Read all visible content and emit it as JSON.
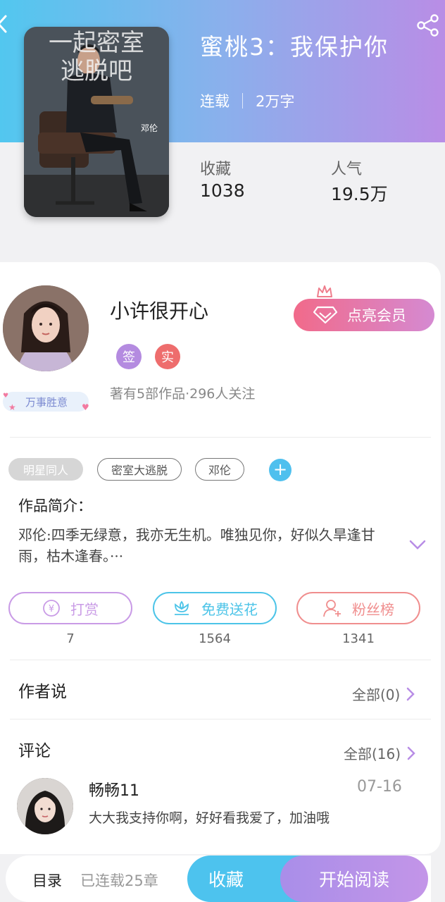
{
  "book": {
    "title": "蜜桃3：我保护你",
    "status": "连载",
    "word_count": "2万字",
    "favorites_label": "收藏",
    "favorites_value": "1038",
    "popularity_label": "人气",
    "popularity_value": "19.5万",
    "cover_text_top": "一起密室",
    "cover_text_bottom": "逃脱吧",
    "cover_author": "邓伦"
  },
  "author": {
    "name": "小许很开心",
    "badge_sign": "签",
    "badge_real": "实",
    "stats": "著有5部作品·296人关注",
    "deco_tag": "万事胜意",
    "vip_button": "点亮会员"
  },
  "tags": [
    "明星同人",
    "密室大逃脱",
    "邓伦"
  ],
  "intro": {
    "title": "作品简介：",
    "text": "邓伦:四季无绿意，我亦无生机。唯独见你，好似久旱逢甘雨，枯木逢春。···"
  },
  "actions": [
    {
      "label": "打赏",
      "count": "7",
      "color": "#c99be6",
      "icon": "yuan-icon"
    },
    {
      "label": "免费送花",
      "count": "1564",
      "color": "#4cc4e8",
      "icon": "flower-icon"
    },
    {
      "label": "粉丝榜",
      "count": "1341",
      "color": "#f08e8e",
      "icon": "fans-icon"
    }
  ],
  "author_says": {
    "title": "作者说",
    "more": "全部(0)"
  },
  "comments": {
    "title": "评论",
    "more": "全部(16)",
    "items": [
      {
        "name": "畅畅11",
        "date": "07-16",
        "text": "大大我支持你啊，好好看我爱了，加油哦"
      }
    ]
  },
  "bottom": {
    "toc_label": "目录",
    "toc_count": "已连载25章",
    "favorite_button": "收藏",
    "read_button": "开始阅读"
  }
}
